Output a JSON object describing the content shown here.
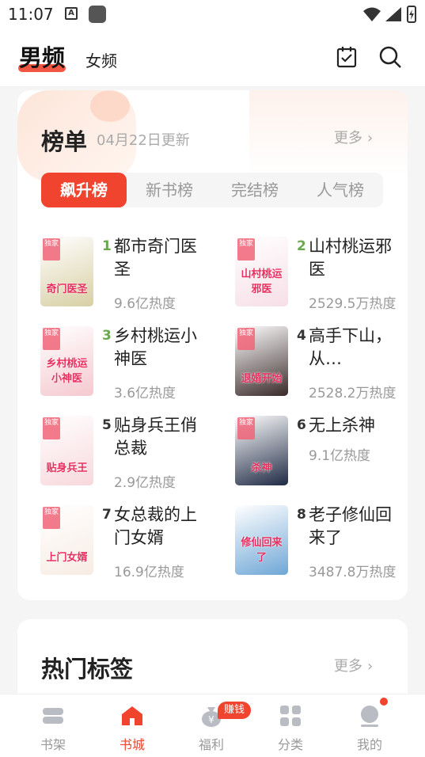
{
  "status_bar": {
    "time": "11:07",
    "a_glyph": "A"
  },
  "header": {
    "tab_male": "男频",
    "tab_female": "女频",
    "icons": [
      "checklist-icon",
      "search-icon"
    ]
  },
  "ranking": {
    "title": "榜单",
    "update_date": "04月22日更新",
    "more": "更多",
    "tabs": [
      "飙升榜",
      "新书榜",
      "完结榜",
      "人气榜"
    ],
    "active_tab": 0,
    "books": [
      {
        "rank": "1",
        "name": "都市奇门医圣",
        "heat": "9.6亿热度",
        "cover_text": "奇门医圣",
        "cover_color": "#d8cfa4",
        "badge": "独家"
      },
      {
        "rank": "2",
        "name": "山村桃运邪医",
        "heat": "2529.5万热度",
        "cover_text": "山村桃运邪医",
        "cover_color": "#f6dfe6",
        "badge": "独家"
      },
      {
        "rank": "3",
        "name": "乡村桃运小神医",
        "heat": "3.6亿热度",
        "cover_text": "乡村桃运小神医",
        "cover_color": "#f4c9cf",
        "badge": "独家"
      },
      {
        "rank": "4",
        "name": "高手下山，从…",
        "heat": "2528.2万热度",
        "cover_text": "退婚开始",
        "cover_color": "#3a2a2a",
        "badge": "独家"
      },
      {
        "rank": "5",
        "name": "贴身兵王俏总裁",
        "heat": "2.9亿热度",
        "cover_text": "贴身兵王",
        "cover_color": "#f7d8dc",
        "badge": "独家"
      },
      {
        "rank": "6",
        "name": "无上杀神",
        "heat": "9.1亿热度",
        "cover_text": "杀神",
        "cover_color": "#1f2a44",
        "badge": "独家"
      },
      {
        "rank": "7",
        "name": "女总裁的上门女婿",
        "heat": "16.9亿热度",
        "cover_text": "上门女婿",
        "cover_color": "#f7ece4",
        "badge": "独家"
      },
      {
        "rank": "8",
        "name": "老子修仙回来了",
        "heat": "3487.8万热度",
        "cover_text": "修仙回来了",
        "cover_color": "#6fa7d6",
        "badge": ""
      }
    ],
    "rank_colors": {
      "top": "#6aa84f",
      "other": "#333333"
    }
  },
  "hot_tags": {
    "title": "热门标签",
    "more": "更多"
  },
  "bottom_nav": {
    "items": [
      {
        "label": "书架",
        "icon": "bookshelf-icon"
      },
      {
        "label": "书城",
        "icon": "bookstore-home-icon"
      },
      {
        "label": "福利",
        "icon": "welfare-moneybag-icon"
      },
      {
        "label": "分类",
        "icon": "category-grid-icon"
      },
      {
        "label": "我的",
        "icon": "profile-icon"
      }
    ],
    "active": 1,
    "earn_badge": "赚钱"
  },
  "colors": {
    "accent": "#f0442e",
    "rank_green": "#6aa84f"
  }
}
